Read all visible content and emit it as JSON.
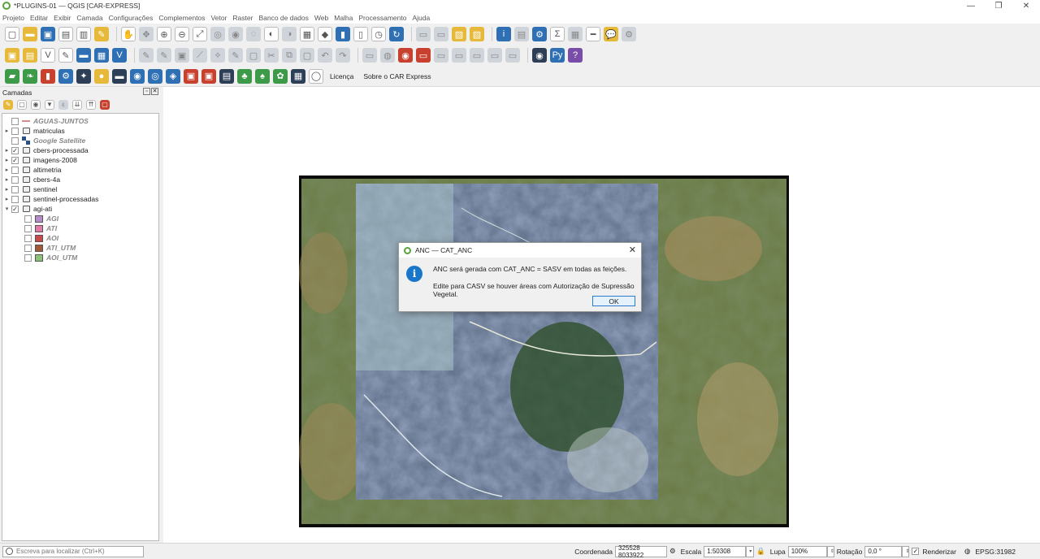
{
  "window": {
    "title": "*PLUGINS-01 — QGIS [CAR-EXPRESS]",
    "controls": [
      "minimize-icon",
      "restore-icon",
      "close-icon"
    ]
  },
  "menu": [
    "Projeto",
    "Editar",
    "Exibir",
    "Camada",
    "Configurações",
    "Complementos",
    "Vetor",
    "Raster",
    "Banco de dados",
    "Web",
    "Malha",
    "Processamento",
    "Ajuda"
  ],
  "plugin_toolbar": {
    "licenca": "Licença",
    "sobre": "Sobre o CAR Express"
  },
  "layers_panel": {
    "title": "Camadas",
    "layers": [
      {
        "name": "AGUAS-JUNTOS",
        "checked": false,
        "style": "italic",
        "icon": "line-layer-icon",
        "color": "#d98a8a",
        "expand": ""
      },
      {
        "name": "matriculas",
        "checked": false,
        "style": "normal",
        "icon": "group-icon",
        "expand": "▸"
      },
      {
        "name": "Google Satellite",
        "checked": false,
        "style": "italic",
        "icon": "raster-tile-icon",
        "expand": ""
      },
      {
        "name": "cbers-processada",
        "checked": true,
        "style": "normal",
        "icon": "group-icon",
        "expand": "▸"
      },
      {
        "name": "imagens-2008",
        "checked": true,
        "style": "normal",
        "icon": "group-icon",
        "expand": "▸"
      },
      {
        "name": "altimetria",
        "checked": false,
        "style": "normal",
        "icon": "group-icon",
        "expand": "▸"
      },
      {
        "name": "cbers-4a",
        "checked": false,
        "style": "normal",
        "icon": "group-icon",
        "expand": "▸"
      },
      {
        "name": "sentinel",
        "checked": false,
        "style": "normal",
        "icon": "group-icon",
        "expand": "▸"
      },
      {
        "name": "sentinel-processadas",
        "checked": false,
        "style": "normal",
        "icon": "group-icon",
        "expand": "▸"
      },
      {
        "name": "agi-ati",
        "checked": true,
        "style": "normal",
        "icon": "group-icon",
        "expand": "▾"
      }
    ],
    "children": [
      {
        "name": "AGI",
        "checked": false,
        "color": "#b48ec9"
      },
      {
        "name": "ATI",
        "checked": false,
        "color": "#e07aa6"
      },
      {
        "name": "AOI",
        "checked": false,
        "color": "#c84a4a"
      },
      {
        "name": "ATI_UTM",
        "checked": false,
        "color": "#a05a3a"
      },
      {
        "name": "AOI_UTM",
        "checked": false,
        "color": "#8fc07a"
      }
    ]
  },
  "dialog": {
    "title": "ANC — CAT_ANC",
    "line1": "ANC será gerada com CAT_ANC = SASV em todas as feições.",
    "line2": "Edite para CASV se houver áreas com Autorização de Supressão Vegetal.",
    "ok": "OK",
    "icon": "info-icon"
  },
  "status": {
    "locate_placeholder": "Escreva para localizar (Ctrl+K)",
    "coord_label": "Coordenada",
    "coord_value": "325528  8033922",
    "scale_label": "Escala",
    "scale_value": "1:50308",
    "lupa_label": "Lupa",
    "lupa_value": "100%",
    "rot_label": "Rotação",
    "rot_value": "0,0 °",
    "render_label": "Renderizar",
    "render_checked": true,
    "crs": "EPSG:31982"
  }
}
